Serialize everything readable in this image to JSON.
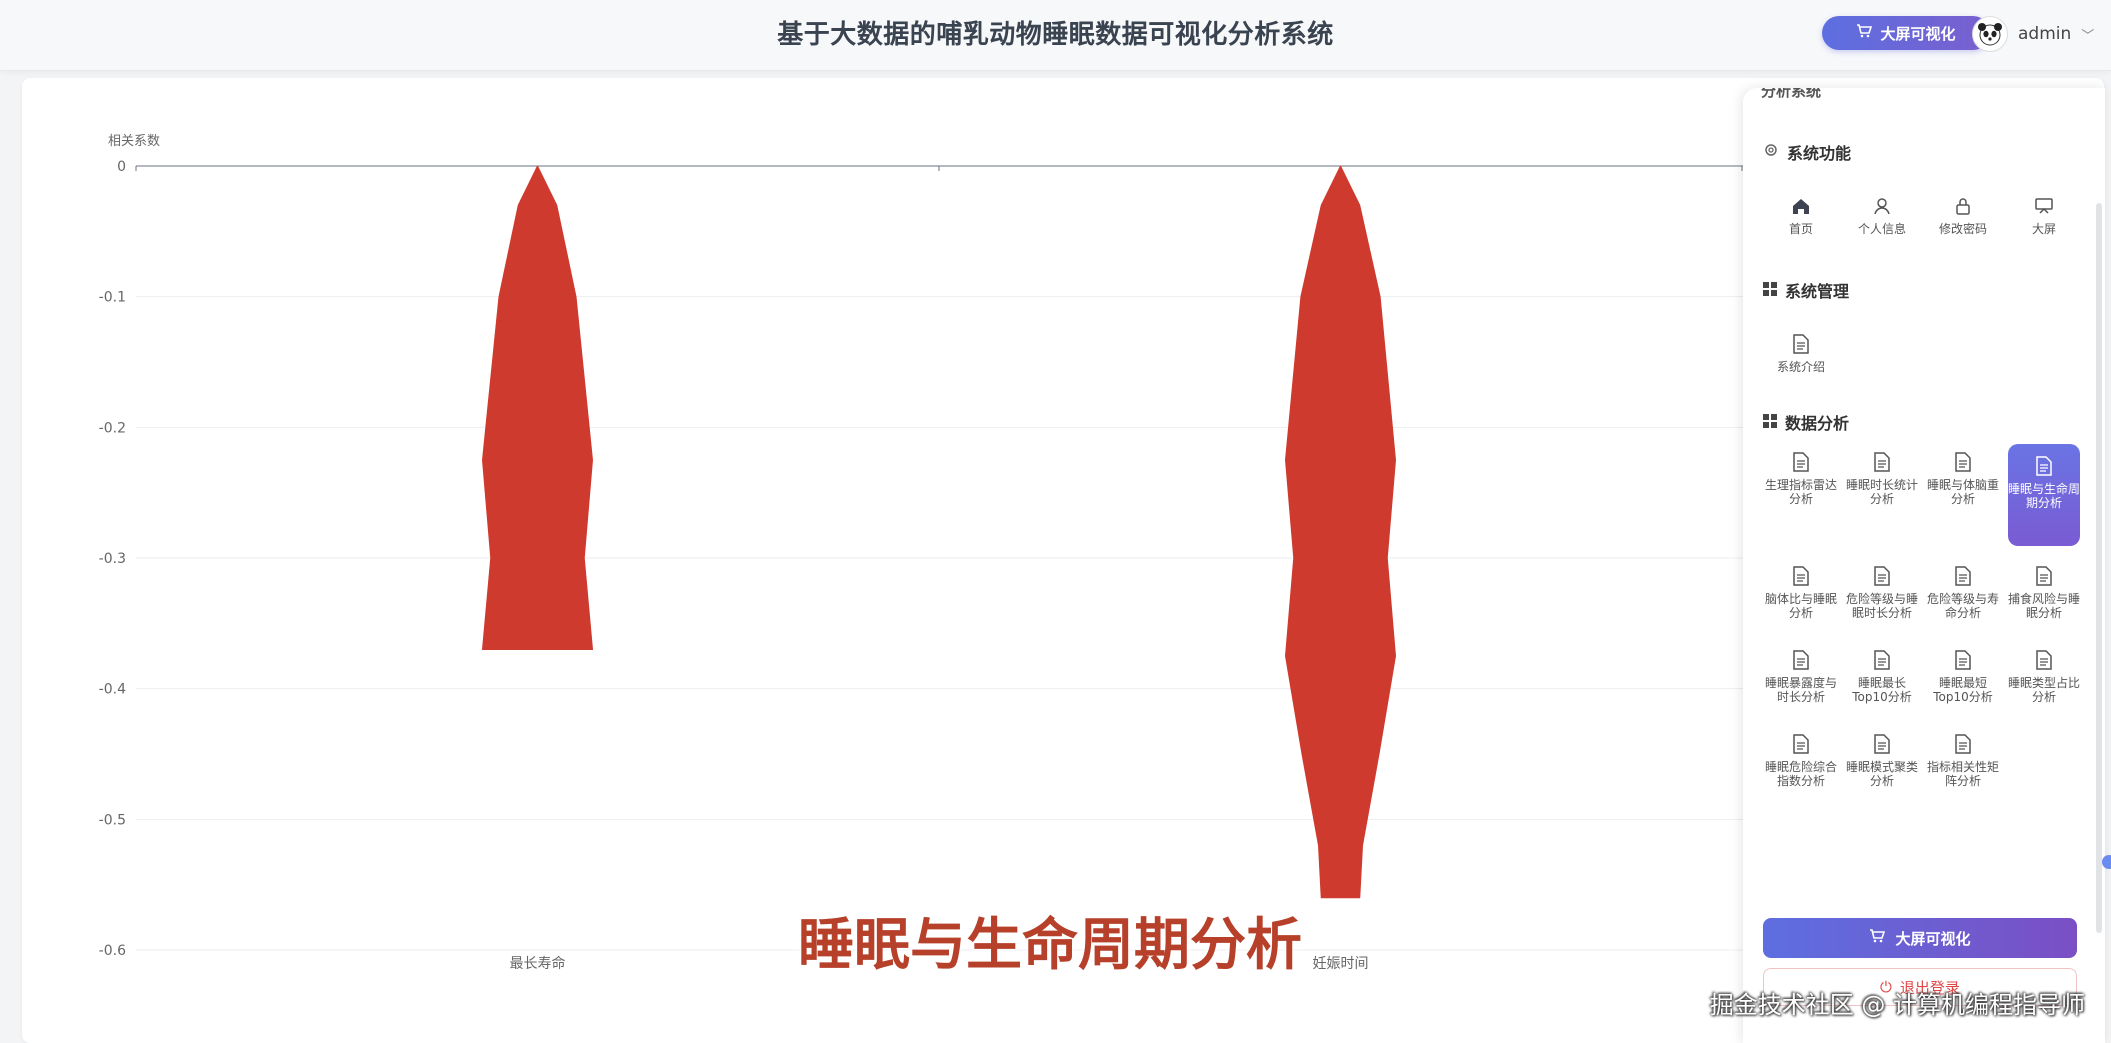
{
  "header": {
    "title": "基于大数据的哺乳动物睡眠数据可视化分析系统",
    "big_screen_label": "大屏可视化",
    "username": "admin"
  },
  "overlay_title": "睡眠与生命周期分析",
  "watermark": "掘金技术社区 @ 计算机编程指导师",
  "chart_data": {
    "type": "violin",
    "ylabel": "相关系数",
    "xlabel": "",
    "categories": [
      "最长寿命",
      "妊娠时间"
    ],
    "ylim": [
      -0.6,
      0
    ],
    "yticks": [
      "0",
      "-0.1",
      "-0.2",
      "-0.3",
      "-0.4",
      "-0.5",
      "-0.6"
    ],
    "series": [
      {
        "color": "#cf3a2f",
        "shapes": [
          {
            "category": "最长寿命",
            "y_min": -0.37,
            "y_max": 0.0,
            "profile": [
              [
                0.0,
                0.0
              ],
              [
                -0.03,
                0.35
              ],
              [
                -0.1,
                0.7
              ],
              [
                -0.225,
                1.0
              ],
              [
                -0.3,
                0.85
              ],
              [
                -0.37,
                1.0
              ]
            ]
          },
          {
            "category": "妊娠时间",
            "y_min": -0.56,
            "y_max": 0.0,
            "profile": [
              [
                0.0,
                0.0
              ],
              [
                -0.03,
                0.35
              ],
              [
                -0.1,
                0.72
              ],
              [
                -0.225,
                1.0
              ],
              [
                -0.3,
                0.85
              ],
              [
                -0.375,
                1.0
              ],
              [
                -0.45,
                0.7
              ],
              [
                -0.52,
                0.4
              ],
              [
                -0.56,
                0.35
              ]
            ]
          }
        ]
      }
    ]
  },
  "panel": {
    "peek_label": "分析系统",
    "sections": [
      {
        "title": "系统功能",
        "icon": "gear-icon",
        "items": [
          {
            "label": "首页",
            "icon": "home-icon"
          },
          {
            "label": "个人信息",
            "icon": "user-icon"
          },
          {
            "label": "修改密码",
            "icon": "lock-icon"
          },
          {
            "label": "大屏",
            "icon": "screen-icon"
          }
        ]
      },
      {
        "title": "系统管理",
        "icon": "grid-icon",
        "items": [
          {
            "label": "系统介绍",
            "icon": "document-icon"
          }
        ]
      },
      {
        "title": "数据分析",
        "icon": "grid-icon",
        "items": [
          {
            "label": "生理指标雷达分析",
            "icon": "document-icon"
          },
          {
            "label": "睡眠时长统计分析",
            "icon": "document-icon"
          },
          {
            "label": "睡眠与体脑重分析",
            "icon": "document-icon"
          },
          {
            "label": "睡眠与生命周期分析",
            "icon": "document-icon",
            "active": true
          },
          {
            "label": "脑体比与睡眠分析",
            "icon": "document-icon"
          },
          {
            "label": "危险等级与睡眠时长分析",
            "icon": "document-icon"
          },
          {
            "label": "危险等级与寿命分析",
            "icon": "document-icon"
          },
          {
            "label": "捕食风险与睡眠分析",
            "icon": "document-icon"
          },
          {
            "label": "睡眠暴露度与时长分析",
            "icon": "document-icon"
          },
          {
            "label": "睡眠最长Top10分析",
            "icon": "document-icon"
          },
          {
            "label": "睡眠最短Top10分析",
            "icon": "document-icon"
          },
          {
            "label": "睡眠类型占比分析",
            "icon": "document-icon"
          },
          {
            "label": "睡眠危险综合指数分析",
            "icon": "document-icon"
          },
          {
            "label": "睡眠模式聚类分析",
            "icon": "document-icon"
          },
          {
            "label": "指标相关性矩阵分析",
            "icon": "document-icon"
          }
        ]
      }
    ],
    "big_screen_button": "大屏可视化",
    "logout_button": "退出登录"
  }
}
